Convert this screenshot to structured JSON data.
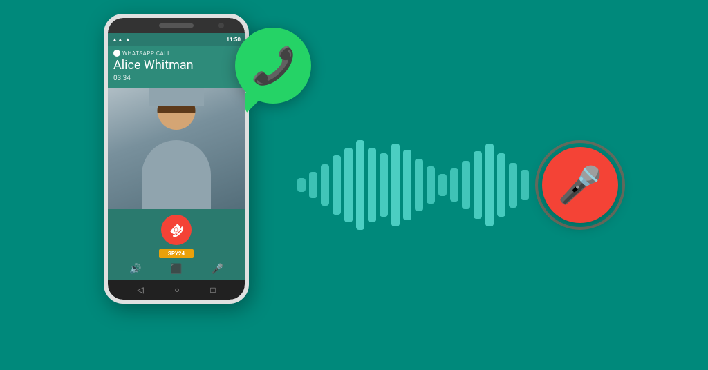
{
  "scene": {
    "bg_color": "#00897B"
  },
  "phone": {
    "status_bar": {
      "signal": "▲▲▲",
      "wifi": "▲",
      "time": "11:50"
    },
    "call_header": {
      "app_label": "WHATSAPP CALL",
      "caller_name": "Alice Whitman",
      "duration": "03:34"
    },
    "spy_badge": "SPY24",
    "end_call_button_label": "End Call",
    "nav": {
      "back": "◁",
      "home": "○",
      "recents": "□"
    }
  },
  "whatsapp": {
    "icon_color": "#25D366"
  },
  "wave_bars": [
    18,
    35,
    55,
    80,
    100,
    120,
    100,
    85,
    110,
    95,
    70,
    50,
    30,
    45,
    65,
    90,
    110,
    85,
    60,
    40
  ],
  "mic": {
    "icon": "🎤",
    "color": "#f44336"
  }
}
